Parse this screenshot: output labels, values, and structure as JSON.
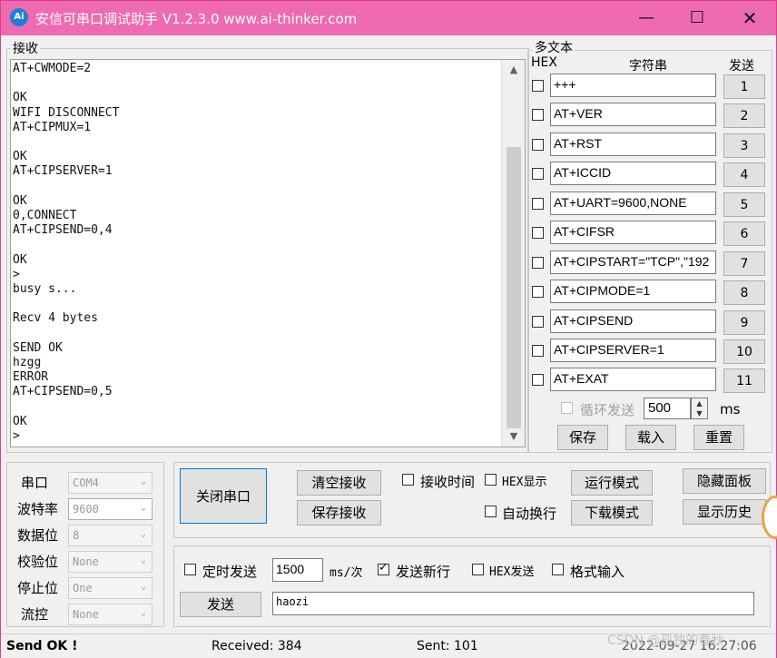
{
  "window": {
    "title": "安信可串口调试助手 V1.2.3.0    www.ai-thinker.com",
    "icon_text": "Ai",
    "accent_color": "#ee6bb1",
    "min_glyph": "—",
    "max_glyph": "☐",
    "close_glyph": "✕"
  },
  "receive": {
    "label": "接收",
    "text": "AT+CWMODE=2\n\nOK\nWIFI DISCONNECT\nAT+CIPMUX=1\n\nOK\nAT+CIPSERVER=1\n\nOK\n0,CONNECT\nAT+CIPSEND=0,4\n\nOK\n>\nbusy s...\n\nRecv 4 bytes\n\nSEND OK\nhzgg\nERROR\nAT+CIPSEND=0,5\n\nOK\n>",
    "scroll_up": "▲",
    "scroll_down": "▼"
  },
  "multi": {
    "label": "多文本",
    "col_hex": "HEX",
    "col_string": "字符串",
    "col_send": "发送",
    "rows": [
      {
        "text": "+++",
        "btn": "1"
      },
      {
        "text": "AT+VER",
        "btn": "2"
      },
      {
        "text": "AT+RST",
        "btn": "3"
      },
      {
        "text": "AT+ICCID",
        "btn": "4"
      },
      {
        "text": "AT+UART=9600,NONE",
        "btn": "5"
      },
      {
        "text": "AT+CIFSR",
        "btn": "6"
      },
      {
        "text": "AT+CIPSTART=\"TCP\",\"192",
        "btn": "7"
      },
      {
        "text": "AT+CIPMODE=1",
        "btn": "8"
      },
      {
        "text": "AT+CIPSEND",
        "btn": "9"
      },
      {
        "text": "AT+CIPSERVER=1",
        "btn": "10"
      },
      {
        "text": "AT+EXAT",
        "btn": "11"
      }
    ],
    "loop_label": "循环发送",
    "loop_ms": "500",
    "ms_unit": "ms",
    "save": "保存",
    "load": "载入",
    "reset": "重置"
  },
  "serial": {
    "port_label": "串口",
    "port_value": "COM4",
    "baud_label": "波特率",
    "baud_value": "9600",
    "databits_label": "数据位",
    "databits_value": "8",
    "parity_label": "校验位",
    "parity_value": "None",
    "stopbits_label": "停止位",
    "stopbits_value": "One",
    "flow_label": "流控",
    "flow_value": "None",
    "dropdown_glyph": "⌄"
  },
  "controls": {
    "close_port": "关闭串口",
    "clear_recv": "清空接收",
    "save_recv": "保存接收",
    "recv_time": "接收时间",
    "hex_display": "HEX显示",
    "auto_wrap": "自动换行",
    "run_mode": "运行模式",
    "download_mode": "下载模式",
    "hide_panel": "隐藏面板",
    "show_history": "显示历史"
  },
  "send": {
    "timed_send": "定时发送",
    "interval": "1500",
    "interval_unit": "ms/次",
    "send_newline": "发送新行",
    "hex_send": "HEX发送",
    "format_input": "格式输入",
    "send_button": "发送",
    "send_text": "haozi"
  },
  "status": {
    "message": "Send OK !",
    "received": "Received: 384",
    "sent": "Sent: 101",
    "datetime": "2022-09-27 16:27:06",
    "watermark": "CSDN @孤独的春秋"
  }
}
